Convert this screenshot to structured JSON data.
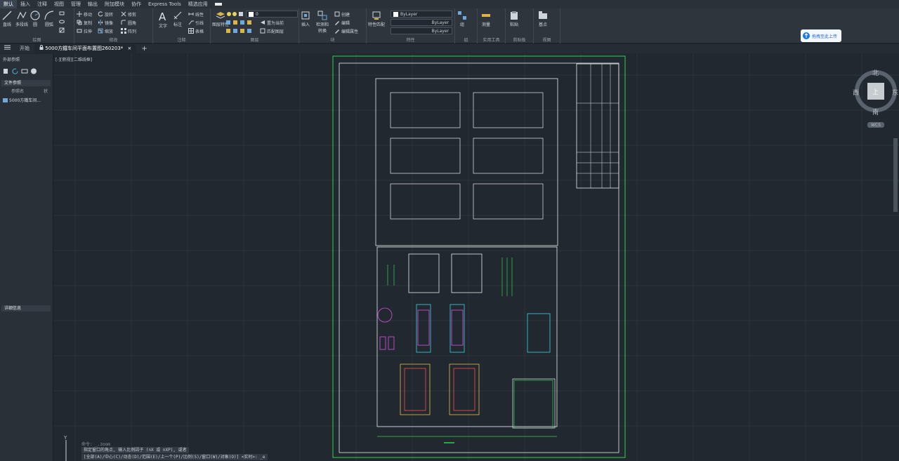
{
  "menu": [
    "默认",
    "插入",
    "注释",
    "视图",
    "管理",
    "输出",
    "附加模块",
    "协作",
    "Express Tools",
    "精选应用"
  ],
  "ribbon": {
    "draw": {
      "label": "绘图",
      "line": "直线",
      "polyline": "多段线",
      "circle": "圆",
      "arc": "圆弧"
    },
    "modify": {
      "label": "修改",
      "move": "移动",
      "rotate": "旋转",
      "trim": "修剪",
      "copy": "复制",
      "mirror": "镜像",
      "fillet": "圆角",
      "stretch": "拉伸",
      "scale": "缩放",
      "array": "阵列"
    },
    "annotation": {
      "label": "注释",
      "text": "文字",
      "dimension": "标注",
      "linear": "线性",
      "leader": "引线",
      "table": "表格"
    },
    "layers": {
      "label": "图层",
      "layer_props": "图层特性",
      "layer_value": "0",
      "make_current": "置为当前",
      "match_layer": "匹配图层"
    },
    "block": {
      "label": "块",
      "insert": "插入",
      "edit_attr": "编辑属性",
      "create": "创建",
      "edit": "编辑",
      "convert": "转换",
      "scale": "检测和"
    },
    "properties": {
      "label": "特性",
      "match": "特性匹配",
      "color": "ByLayer",
      "linetype": "ByLayer",
      "lineweight": "ByLayer"
    },
    "groups": {
      "label": "组",
      "group": "组"
    },
    "utilities": {
      "label": "实用工具",
      "measure": "测量"
    },
    "clipboard": {
      "label": "剪贴板",
      "paste": "粘贴"
    },
    "view": {
      "label": "视图",
      "base": "基点"
    }
  },
  "upload_label": "拖拽至此上传",
  "tabs": {
    "start": "开始",
    "doc": "5000方鐵车间平面布置图260203*"
  },
  "left_panel": {
    "title": "外部参照",
    "file_refs": "文件参照",
    "col_name": "参照名",
    "col_status": "状",
    "item": "5000方鐵车间...",
    "details": "详细信息"
  },
  "view_label": "[-][俯视][二维线框]",
  "compass": {
    "north": "北",
    "south": "南",
    "west": "西",
    "east": "东",
    "top": "上",
    "wcs": "WCS"
  },
  "command": {
    "line1": "命令: _.zoom",
    "line2": "指定窗口的角点, 输入比例因子 (nX 或 nXP), 或者",
    "line3": "[全部(A)/中心(C)/动态(D)/范围(E)/上一个(P)/比例(S)/窗口(W)/对象(O)] <实时>: _e"
  },
  "ucs": {
    "y": "Y"
  }
}
